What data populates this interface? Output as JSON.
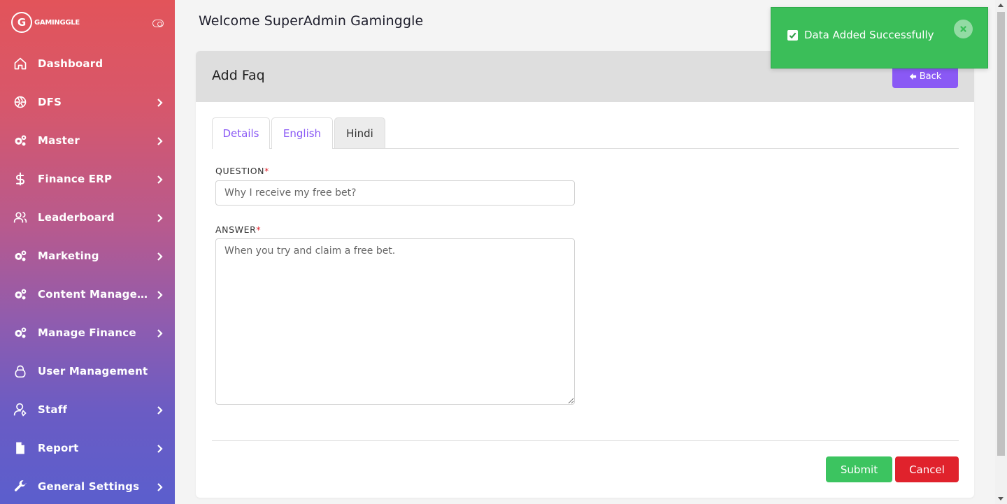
{
  "brand": {
    "logo_letter": "G",
    "name": "GAMINGGLE"
  },
  "sidebar": {
    "items": [
      {
        "label": "Dashboard",
        "icon": "home-icon",
        "has_submenu": false
      },
      {
        "label": "DFS",
        "icon": "aperture-icon",
        "has_submenu": true
      },
      {
        "label": "Master",
        "icon": "cogs-icon",
        "has_submenu": true
      },
      {
        "label": "Finance ERP",
        "icon": "dollar-icon",
        "has_submenu": true
      },
      {
        "label": "Leaderboard",
        "icon": "users-icon",
        "has_submenu": true
      },
      {
        "label": "Marketing",
        "icon": "cogs-icon",
        "has_submenu": true
      },
      {
        "label": "Content Management",
        "icon": "cogs-icon",
        "has_submenu": true
      },
      {
        "label": "Manage Finance",
        "icon": "cogs-icon",
        "has_submenu": true
      },
      {
        "label": "User Management",
        "icon": "user-icon",
        "has_submenu": false
      },
      {
        "label": "Staff",
        "icon": "user-tie-icon",
        "has_submenu": true
      },
      {
        "label": "Report",
        "icon": "file-icon",
        "has_submenu": true
      },
      {
        "label": "General Settings",
        "icon": "wrench-icon",
        "has_submenu": true
      }
    ]
  },
  "header": {
    "welcome": "Welcome SuperAdmin Gaminggle"
  },
  "card": {
    "title": "Add Faq",
    "back_label": "Back",
    "tabs": [
      {
        "label": "Details",
        "active": false
      },
      {
        "label": "English",
        "active": false
      },
      {
        "label": "Hindi",
        "active": true
      }
    ],
    "question_label": "QUESTION",
    "question_value": "Why I receive my free bet?",
    "answer_label": "ANSWER",
    "answer_value": "When you try and claim a free bet.",
    "required_mark": "*",
    "submit_label": "Submit",
    "cancel_label": "Cancel"
  },
  "toast": {
    "message": "Data Added Successfully"
  },
  "colors": {
    "accent": "#8a59f5",
    "success": "#3cc460",
    "danger": "#e0222c",
    "sidebar_top": "#e2545a",
    "sidebar_bottom": "#5b5ecd"
  }
}
